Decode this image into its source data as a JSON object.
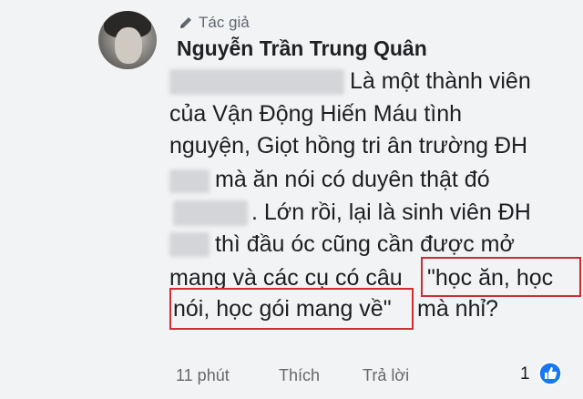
{
  "comment": {
    "role_badge": "Tác giả",
    "author_name": "Nguyễn Trần Trung Quân",
    "lines": [
      "Là một thành viên",
      "của Vận Động Hiến Máu tình",
      "nguyện, Giọt hồng tri ân trường  ĐH",
      "mà ăn nói có duyên thật đó",
      ". Lớn rồi, lại là sinh viên ĐH",
      "thì đầu óc cũng cần được mở",
      "mang và các cụ có câu",
      "\"học ăn, học",
      "nói, học gói mang về\"",
      "mà nhỉ?"
    ]
  },
  "footer": {
    "time": "11 phút",
    "like_label": "Thích",
    "reply_label": "Trả lời",
    "reaction_count": "1"
  },
  "colors": {
    "accent_blue": "#1877f2",
    "highlight_red": "#d12b35"
  },
  "icons": [
    "pencil-icon",
    "like-reaction-icon"
  ]
}
